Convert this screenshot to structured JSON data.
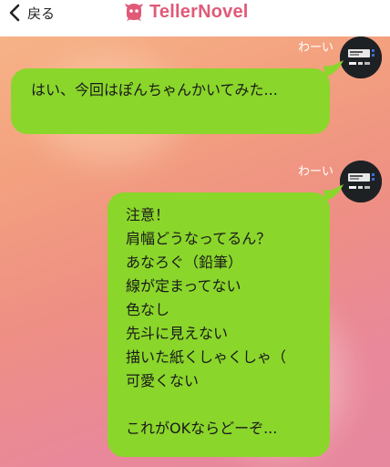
{
  "header": {
    "back_label": "戻る",
    "logo_text": "TellerNovel"
  },
  "messages": [
    {
      "sender": "わーい",
      "text": "はい、今回はぽんちゃんかいてみた..."
    },
    {
      "sender": "わーい",
      "text": "注意！\n肩幅どうなってるん？\nあなろぐ（鉛筆）\n線が定まってない\n色なし\n先斗に見えない\n描いた紙くしゃくしゃ（\n可愛くない\n\nこれがOKならどーぞ..."
    }
  ],
  "colors": {
    "bubble": "#8ad62b",
    "logo": "#e05a78",
    "background_top": "#f7b889",
    "background_bottom": "#e8889f"
  }
}
